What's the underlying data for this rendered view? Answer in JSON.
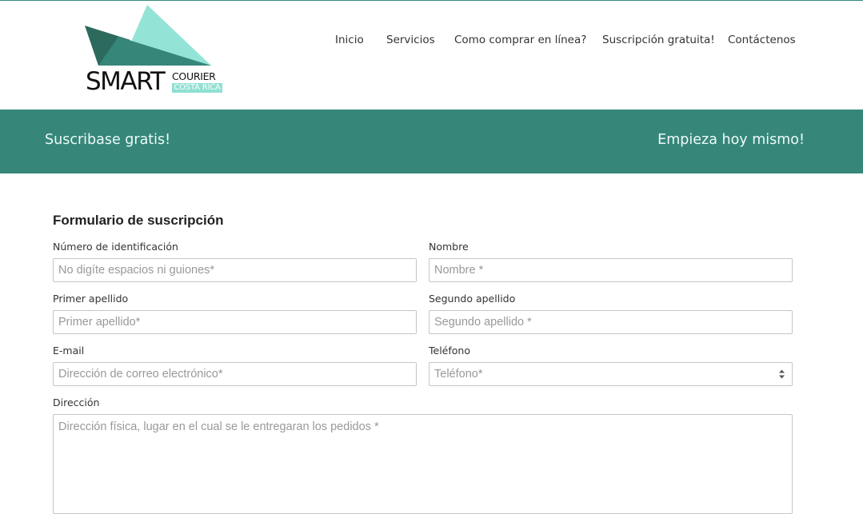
{
  "brand": {
    "name_main": "SMART",
    "name_sub": "COURIER",
    "region": "COSTA RICA",
    "colors": {
      "light": "#93e4d6",
      "mid": "#36877a",
      "dark": "#2c6a5d"
    }
  },
  "nav": {
    "items": [
      {
        "label": "Inicio"
      },
      {
        "label": "Servicios"
      },
      {
        "label": "Como comprar en línea?"
      },
      {
        "label": "Suscripción gratuita!"
      },
      {
        "label": "Contáctenos"
      }
    ]
  },
  "banner": {
    "left_text": "Suscribase gratis!",
    "right_text": "Empieza hoy mismo!",
    "color": "#36877a"
  },
  "form": {
    "title": "Formulario de suscripción",
    "fields": {
      "id_number": {
        "label": "Número de identificación",
        "placeholder": "No digíte espacios ni guiones*",
        "value": ""
      },
      "first_name": {
        "label": "Nombre",
        "placeholder": "Nombre *",
        "value": ""
      },
      "last_name_1": {
        "label": "Primer apellido",
        "placeholder": "Primer apellido*",
        "value": ""
      },
      "last_name_2": {
        "label": "Segundo apellido",
        "placeholder": "Segundo apellido *",
        "value": ""
      },
      "email": {
        "label": "E-mail",
        "placeholder": "Dirección de correo electrónico*",
        "value": ""
      },
      "phone": {
        "label": "Teléfono",
        "placeholder": "Teléfono*",
        "value": ""
      },
      "address": {
        "label": "Dirección",
        "placeholder": "Dirección física, lugar en el cual se le entregaran los pedidos *",
        "value": ""
      }
    }
  }
}
